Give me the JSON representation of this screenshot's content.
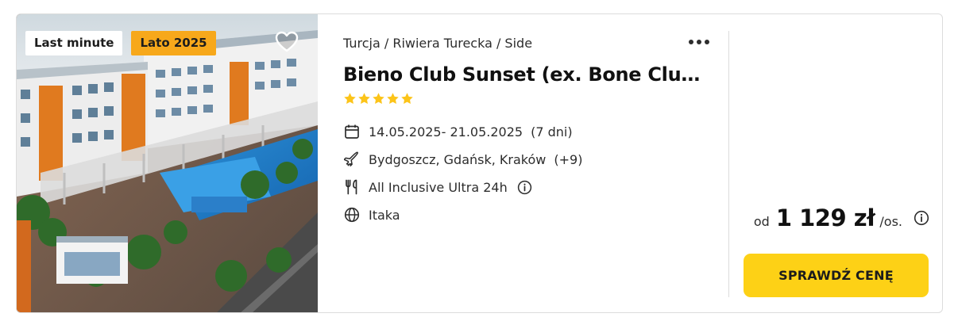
{
  "offer": {
    "badges": [
      "Last minute",
      "Lato 2025"
    ],
    "breadcrumb": "Turcja / Riwiera Turecka / Side",
    "title": "Bieno Club Sunset (ex. Bone Club Sunset Hotel & Spa)",
    "star_rating": 5,
    "dates": "14.05.2025- 21.05.2025",
    "duration": "(7 dni)",
    "departure": "Bydgoszcz, Gdańsk, Kraków",
    "departure_more": "(+9)",
    "board": "All Inclusive Ultra 24h",
    "operator": "Itaka",
    "icons": {
      "calendar": "calendar-icon",
      "plane": "plane-icon",
      "board": "cutlery-icon",
      "operator": "globe-icon",
      "info": "info-icon",
      "favorite": "heart-icon",
      "more": "more-dots-icon"
    }
  },
  "price": {
    "prefix": "od",
    "amount": "1 129 zł",
    "suffix": "/os."
  },
  "cta": {
    "label": "SPRAWDŹ CENĘ"
  },
  "colors": {
    "accent_yellow": "#fdd116",
    "badge_orange": "#f7a81b",
    "star": "#fcc419",
    "text": "#1c1c1c",
    "border": "#dcdcdc"
  }
}
